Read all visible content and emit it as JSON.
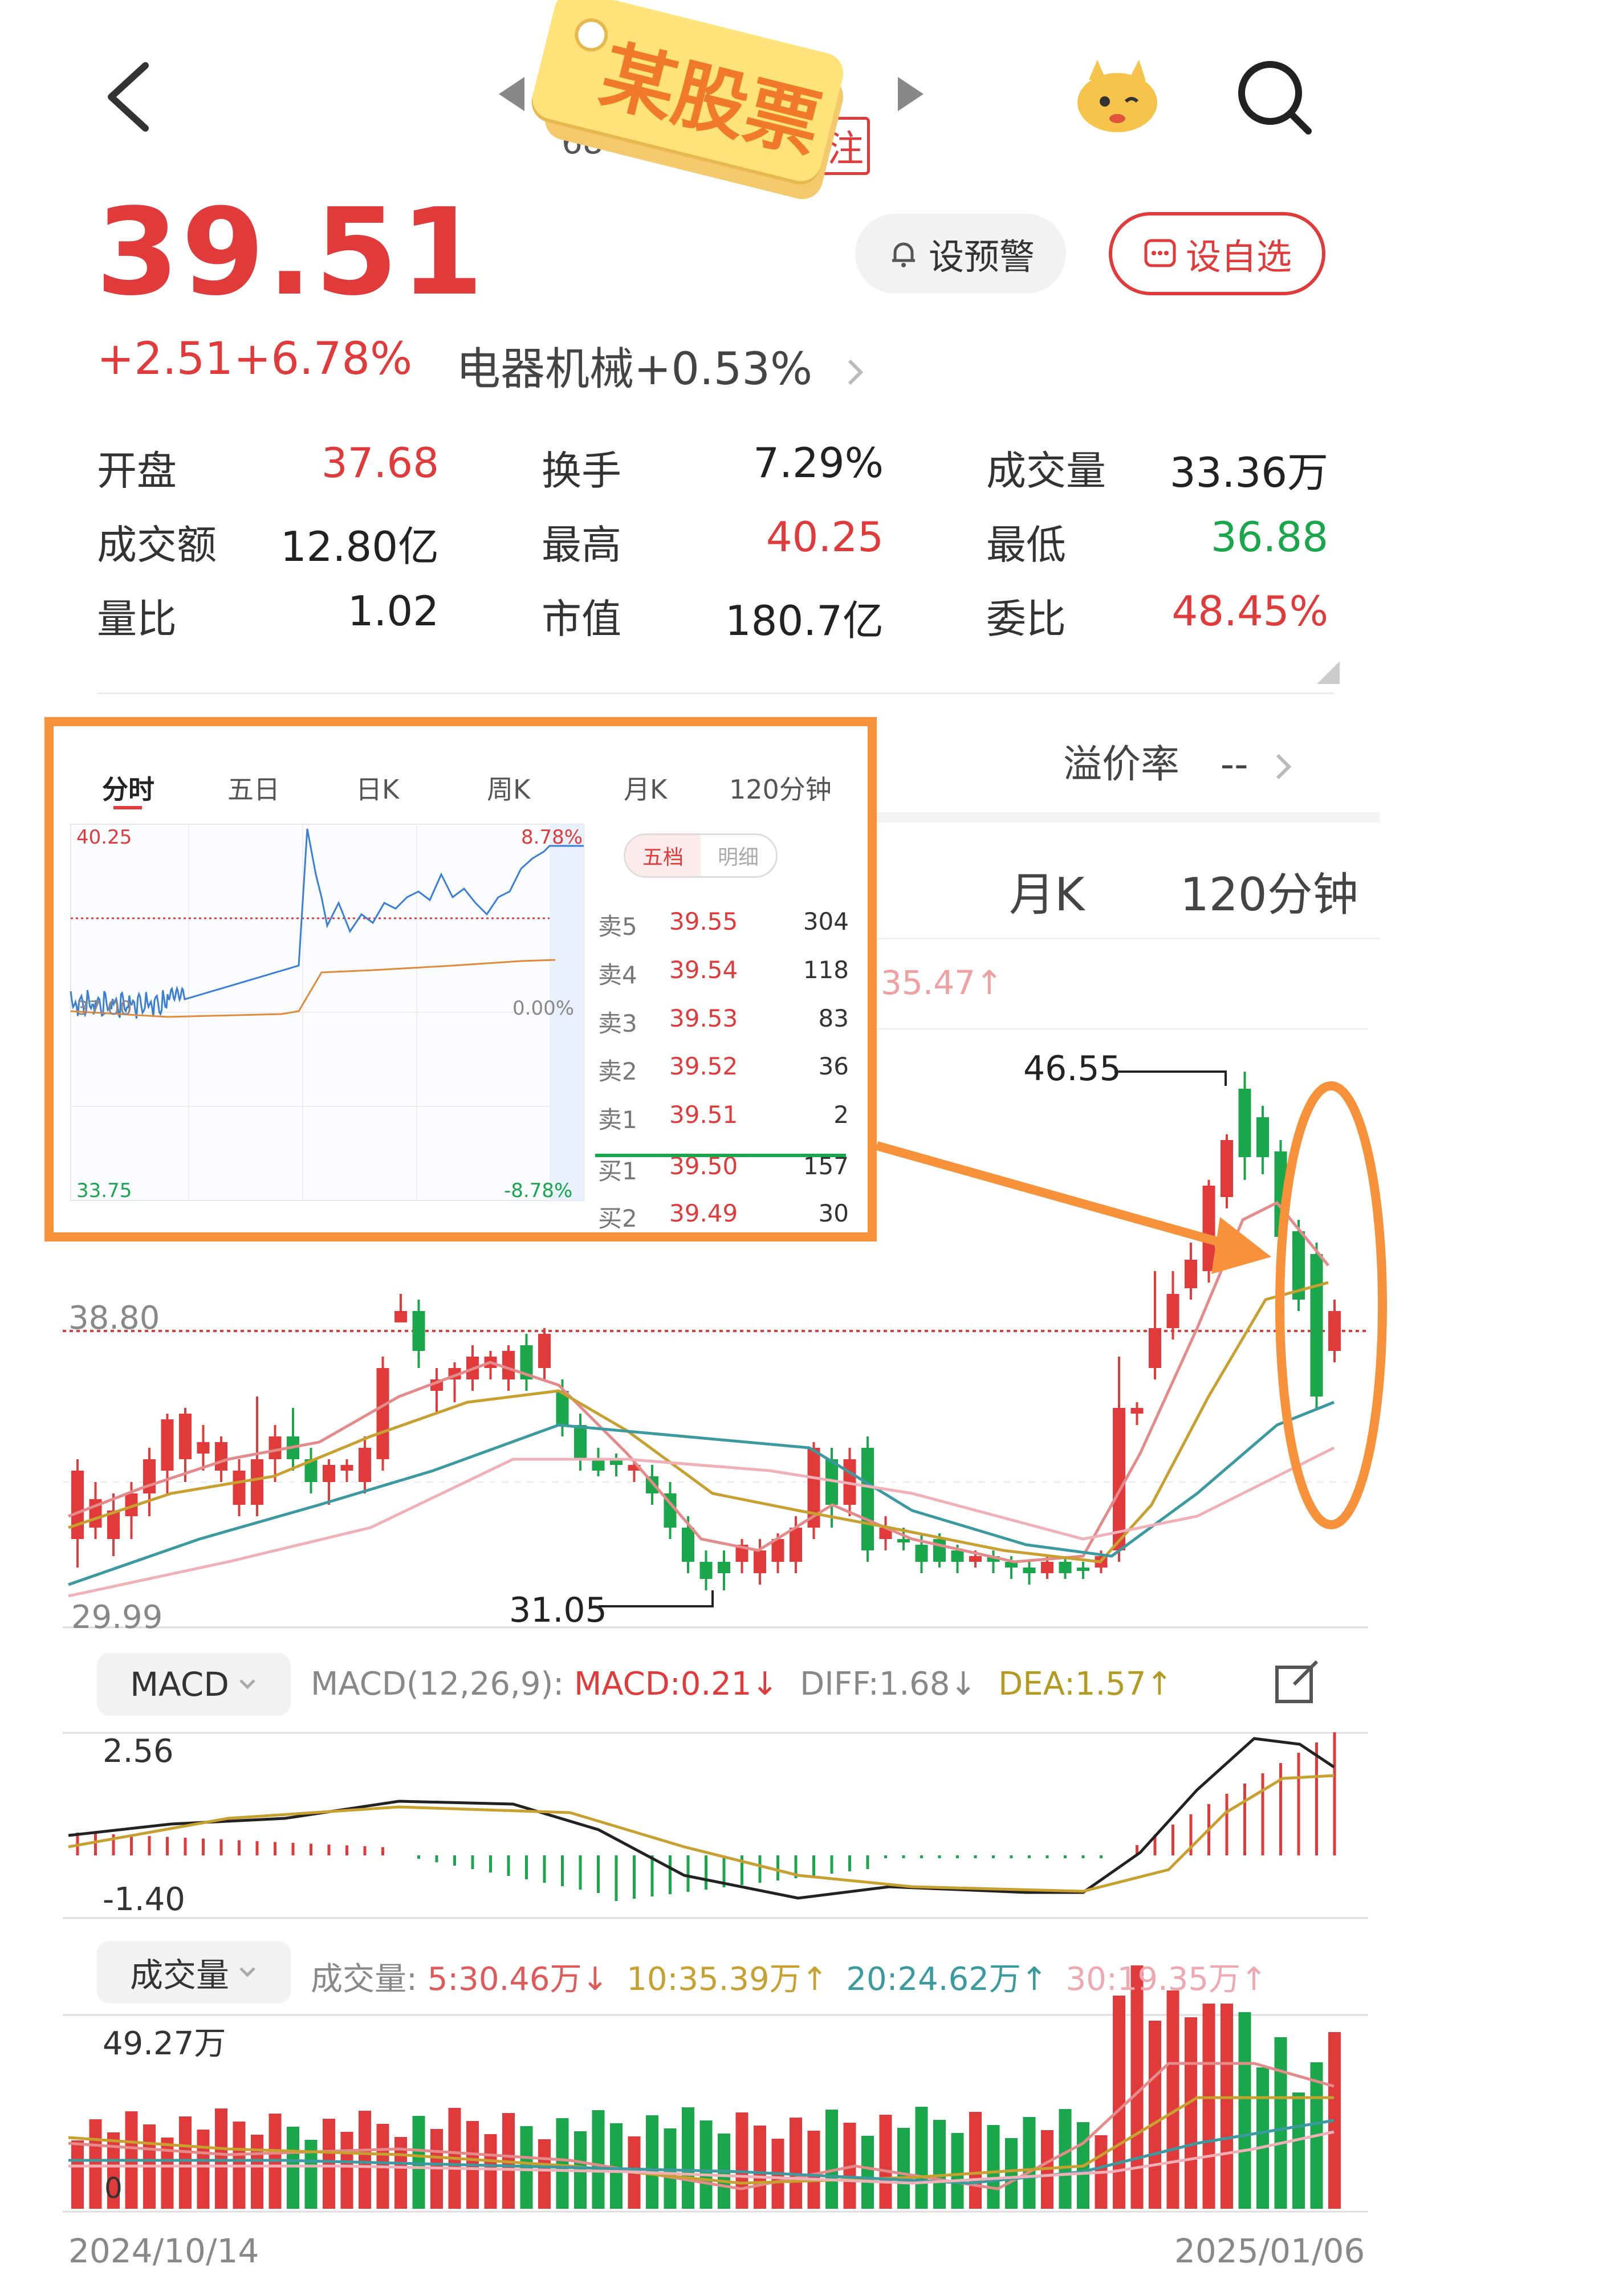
{
  "header": {
    "back_icon": "chevron-left-icon",
    "prev_icon": "triangle-left-icon",
    "next_icon": "triangle-right-icon",
    "tag_text": "某股票",
    "tag_partial_code": "68",
    "tag_partial_right": "注",
    "mascot_icon": "mascot-icon",
    "search_icon": "search-icon"
  },
  "quote": {
    "price": "39.51",
    "change": "+2.51",
    "change_pct": "+6.78%",
    "sector": "电器机械",
    "sector_pct": "+0.53%",
    "alert_label": "设预警",
    "watch_label": "设自选"
  },
  "stats": [
    {
      "label": "开盘",
      "value": "37.68",
      "color": "red"
    },
    {
      "label": "换手",
      "value": "7.29%",
      "color": "black"
    },
    {
      "label": "成交量",
      "value": "33.36万",
      "color": "black"
    },
    {
      "label": "成交额",
      "value": "12.80亿",
      "color": "black"
    },
    {
      "label": "最高",
      "value": "40.25",
      "color": "red"
    },
    {
      "label": "最低",
      "value": "36.88",
      "color": "green"
    },
    {
      "label": "量比",
      "value": "1.02",
      "color": "black"
    },
    {
      "label": "市值",
      "value": "180.7亿",
      "color": "black"
    },
    {
      "label": "委比",
      "value": "48.45%",
      "color": "red"
    }
  ],
  "premium": {
    "label": "溢价率",
    "value": "--"
  },
  "tabs_large": {
    "monthly": "月K",
    "min120": "120分钟"
  },
  "ma_partial_label": "35.47",
  "kline": {
    "high_label": "46.55",
    "low_label": "31.05",
    "y_top_label": "38.80",
    "y_bottom_label": "29.99",
    "date_start": "2024/10/14",
    "date_end": "2025/01/06"
  },
  "macd": {
    "selector": "MACD",
    "params": "MACD(12,26,9):",
    "macd": "MACD:0.21",
    "diff": "DIFF:1.68",
    "dea": "DEA:1.57",
    "y_top": "2.56",
    "y_bottom": "-1.40",
    "edit_icon": "edit-icon"
  },
  "volume": {
    "selector": "成交量",
    "prefix": "成交量:",
    "ma5": "5:30.46万",
    "ma10": "10:35.39万",
    "ma20": "20:24.62万",
    "ma30": "30:19.35万",
    "y_top": "49.27万",
    "y_bottom": "0"
  },
  "inset": {
    "tabs": [
      "分时",
      "五日",
      "日K",
      "周K",
      "月K",
      "120分钟"
    ],
    "price_top": "40.25",
    "price_mid": "37.00",
    "price_bottom": "33.75",
    "pct_top": "8.78%",
    "pct_mid": "0.00%",
    "pct_bottom": "-8.78%",
    "ob_tabs": [
      "五档",
      "明细"
    ],
    "order_book": [
      {
        "label": "卖5",
        "price": "39.55",
        "vol": "304"
      },
      {
        "label": "卖4",
        "price": "39.54",
        "vol": "118"
      },
      {
        "label": "卖3",
        "price": "39.53",
        "vol": "83"
      },
      {
        "label": "卖2",
        "price": "39.52",
        "vol": "36"
      },
      {
        "label": "卖1",
        "price": "39.51",
        "vol": "2"
      },
      {
        "label": "买1",
        "price": "39.50",
        "vol": "157"
      },
      {
        "label": "买2",
        "price": "39.49",
        "vol": "30"
      }
    ]
  },
  "colors": {
    "up": "#e03a3a",
    "down": "#1aa64a",
    "accent": "#f7913a"
  }
}
